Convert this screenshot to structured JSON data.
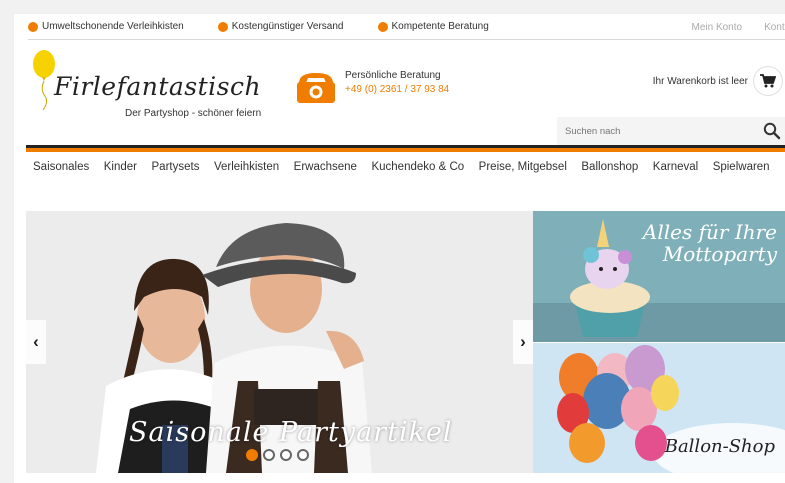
{
  "usp": [
    {
      "label": "Umweltschonende Verleihkisten"
    },
    {
      "label": "Kostengünstiger Versand"
    },
    {
      "label": "Kompetente Beratung"
    }
  ],
  "meta": {
    "account": "Mein Konto",
    "contact": "Kontakt"
  },
  "logo": {
    "brand": "Firlefantastisch",
    "tagline": "Der Partyshop - schöner feiern"
  },
  "contact": {
    "label": "Persönliche Beratung",
    "phone": "+49 (0) 2361 / 37 93 84"
  },
  "cart": {
    "label": "Ihr Warenkorb ist leer"
  },
  "search": {
    "placeholder": "Suchen nach"
  },
  "nav": [
    {
      "label": "Saisonales"
    },
    {
      "label": "Kinder"
    },
    {
      "label": "Partysets"
    },
    {
      "label": "Verleihkisten"
    },
    {
      "label": "Erwachsene"
    },
    {
      "label": "Kuchendeko & Co"
    },
    {
      "label": "Preise, Mitgebsel"
    },
    {
      "label": "Ballonshop"
    },
    {
      "label": "Karneval"
    },
    {
      "label": "Spielwaren"
    }
  ],
  "slider": {
    "caption": "Saisonale Partyartikel",
    "prev": "‹",
    "next": "›",
    "slide_count": 4,
    "active_index": 0
  },
  "teasers": {
    "top": {
      "line1": "Alles für Ihre",
      "line2": "Mottoparty"
    },
    "bottom": {
      "title": "Ballon-Shop"
    }
  },
  "colors": {
    "accent": "#f07d00",
    "dark": "#222222"
  },
  "icons": {
    "usp": "orange-dot-icon",
    "balloon": "balloon-icon",
    "phone": "telephone-icon",
    "cart": "cart-icon",
    "search": "search-icon"
  }
}
